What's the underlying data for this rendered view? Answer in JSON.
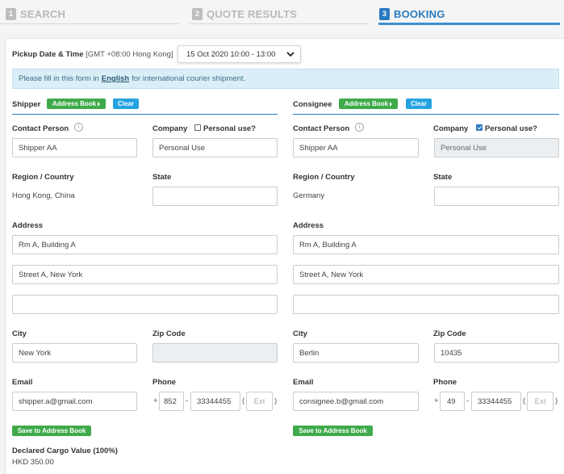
{
  "steps": [
    {
      "num": "1",
      "label": "SEARCH"
    },
    {
      "num": "2",
      "label": "QUOTE RESULTS"
    },
    {
      "num": "3",
      "label": "BOOKING"
    }
  ],
  "pickup": {
    "label": "Pickup Date & Time",
    "timezone": "[GMT +08:00 Hong Kong]",
    "value": "15 Oct 2020 10:00 - 13:00"
  },
  "notice": {
    "prefix": "Please fill in this form in",
    "link": "English",
    "suffix": "for international courier shipment."
  },
  "shipper": {
    "title": "Shipper",
    "address_book": "Address Book",
    "clear": "Clear",
    "contact_label": "Contact Person",
    "contact_value": "Shipper AA",
    "company_label": "Company",
    "personal_label": "Personal use?",
    "personal_checked": false,
    "company_value": "Personal Use",
    "region_label": "Region / Country",
    "region_value": "Hong Kong, China",
    "state_label": "State",
    "state_value": "",
    "address_label": "Address",
    "address1": "Rm A, Building A",
    "address2": "Street A, New York",
    "address3": "",
    "city_label": "City",
    "city_value": "New York",
    "zip_label": "Zip Code",
    "zip_value": "",
    "email_label": "Email",
    "email_value": "shipper.a@gmail.com",
    "phone_label": "Phone",
    "phone_plus": "+",
    "phone_code": "852",
    "phone_dash": "-",
    "phone_number": "33344455",
    "ext_open": "(",
    "ext_placeholder": "Ext",
    "ext_close": ")",
    "save": "Save to Address Book"
  },
  "consignee": {
    "title": "Consignee",
    "address_book": "Address Book",
    "clear": "Clear",
    "contact_label": "Contact Person",
    "contact_value": "Shipper AA",
    "company_label": "Company",
    "personal_label": "Personal use?",
    "personal_checked": true,
    "company_value": "Personal Use",
    "region_label": "Region / Country",
    "region_value": "Germany",
    "state_label": "State",
    "state_value": "",
    "address_label": "Address",
    "address1": "Rm A, Building A",
    "address2": "Street A, New York",
    "address3": "",
    "city_label": "City",
    "city_value": "Berlin",
    "zip_label": "Zip Code",
    "zip_value": "10435",
    "email_label": "Email",
    "email_value": "consignee.b@gmail.com",
    "phone_label": "Phone",
    "phone_plus": "+",
    "phone_code": "49",
    "phone_dash": "-",
    "phone_number": "33344455",
    "ext_open": "(",
    "ext_placeholder": "Ext",
    "ext_close": ")",
    "save": "Save to Address Book"
  },
  "cargo": {
    "label": "Declared Cargo Value (100%)",
    "value": "HKD 350.00"
  },
  "colors": {
    "accent": "#2a7bc0",
    "green": "#3faa4a",
    "blue": "#24a3e0",
    "notice_bg": "#d9eef6"
  }
}
